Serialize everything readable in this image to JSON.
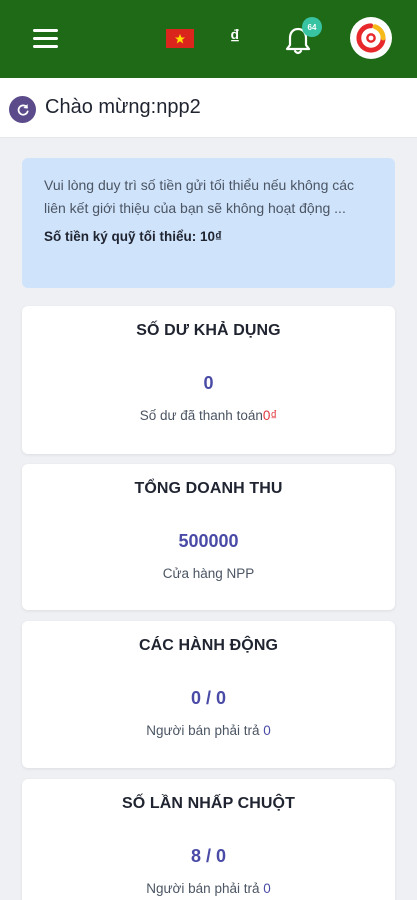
{
  "header": {
    "currency_symbol": "₫",
    "notification_count": "64",
    "flag": "vietnam-flag",
    "bg_color": "#1f6a17"
  },
  "welcome": {
    "text": "Chào mừng:npp2"
  },
  "notice": {
    "text": "Vui lòng duy trì số tiền gửi tối thiểu nếu không các liên kết giới thiệu của bạn sẽ không hoạt động ...",
    "deposit_label": "Số tiền ký quỹ tối thiểu: 10₫"
  },
  "cards": [
    {
      "title": "SỐ DƯ KHẢ DỤNG",
      "value": "0",
      "sub_label": "Số dư đã thanh toán",
      "sub_value": "0₫"
    },
    {
      "title": "TỔNG DOANH THU",
      "value": "500000",
      "sub_label": "Cửa hàng NPP",
      "sub_value": ""
    },
    {
      "title": "CÁC HÀNH ĐỘNG",
      "value": "0 / 0",
      "sub_label": "Người bán phải trả ",
      "sub_value": "0"
    },
    {
      "title": "SỐ LẦN NHẤP CHUỘT",
      "value": "8 / 0",
      "sub_label": "Người bán phải trả ",
      "sub_value": "0"
    }
  ],
  "colors": {
    "accent": "#4a4ba6",
    "negative": "#e0383e",
    "notice_bg": "#cfe3fb",
    "badge": "#38c3a3"
  }
}
